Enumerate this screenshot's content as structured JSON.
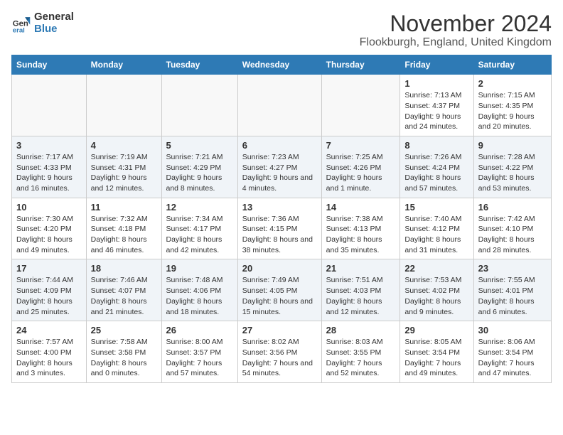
{
  "logo": {
    "line1": "General",
    "line2": "Blue"
  },
  "title": "November 2024",
  "subtitle": "Flookburgh, England, United Kingdom",
  "days_of_week": [
    "Sunday",
    "Monday",
    "Tuesday",
    "Wednesday",
    "Thursday",
    "Friday",
    "Saturday"
  ],
  "weeks": [
    [
      {
        "day": "",
        "info": ""
      },
      {
        "day": "",
        "info": ""
      },
      {
        "day": "",
        "info": ""
      },
      {
        "day": "",
        "info": ""
      },
      {
        "day": "",
        "info": ""
      },
      {
        "day": "1",
        "info": "Sunrise: 7:13 AM\nSunset: 4:37 PM\nDaylight: 9 hours and 24 minutes."
      },
      {
        "day": "2",
        "info": "Sunrise: 7:15 AM\nSunset: 4:35 PM\nDaylight: 9 hours and 20 minutes."
      }
    ],
    [
      {
        "day": "3",
        "info": "Sunrise: 7:17 AM\nSunset: 4:33 PM\nDaylight: 9 hours and 16 minutes."
      },
      {
        "day": "4",
        "info": "Sunrise: 7:19 AM\nSunset: 4:31 PM\nDaylight: 9 hours and 12 minutes."
      },
      {
        "day": "5",
        "info": "Sunrise: 7:21 AM\nSunset: 4:29 PM\nDaylight: 9 hours and 8 minutes."
      },
      {
        "day": "6",
        "info": "Sunrise: 7:23 AM\nSunset: 4:27 PM\nDaylight: 9 hours and 4 minutes."
      },
      {
        "day": "7",
        "info": "Sunrise: 7:25 AM\nSunset: 4:26 PM\nDaylight: 9 hours and 1 minute."
      },
      {
        "day": "8",
        "info": "Sunrise: 7:26 AM\nSunset: 4:24 PM\nDaylight: 8 hours and 57 minutes."
      },
      {
        "day": "9",
        "info": "Sunrise: 7:28 AM\nSunset: 4:22 PM\nDaylight: 8 hours and 53 minutes."
      }
    ],
    [
      {
        "day": "10",
        "info": "Sunrise: 7:30 AM\nSunset: 4:20 PM\nDaylight: 8 hours and 49 minutes."
      },
      {
        "day": "11",
        "info": "Sunrise: 7:32 AM\nSunset: 4:18 PM\nDaylight: 8 hours and 46 minutes."
      },
      {
        "day": "12",
        "info": "Sunrise: 7:34 AM\nSunset: 4:17 PM\nDaylight: 8 hours and 42 minutes."
      },
      {
        "day": "13",
        "info": "Sunrise: 7:36 AM\nSunset: 4:15 PM\nDaylight: 8 hours and 38 minutes."
      },
      {
        "day": "14",
        "info": "Sunrise: 7:38 AM\nSunset: 4:13 PM\nDaylight: 8 hours and 35 minutes."
      },
      {
        "day": "15",
        "info": "Sunrise: 7:40 AM\nSunset: 4:12 PM\nDaylight: 8 hours and 31 minutes."
      },
      {
        "day": "16",
        "info": "Sunrise: 7:42 AM\nSunset: 4:10 PM\nDaylight: 8 hours and 28 minutes."
      }
    ],
    [
      {
        "day": "17",
        "info": "Sunrise: 7:44 AM\nSunset: 4:09 PM\nDaylight: 8 hours and 25 minutes."
      },
      {
        "day": "18",
        "info": "Sunrise: 7:46 AM\nSunset: 4:07 PM\nDaylight: 8 hours and 21 minutes."
      },
      {
        "day": "19",
        "info": "Sunrise: 7:48 AM\nSunset: 4:06 PM\nDaylight: 8 hours and 18 minutes."
      },
      {
        "day": "20",
        "info": "Sunrise: 7:49 AM\nSunset: 4:05 PM\nDaylight: 8 hours and 15 minutes."
      },
      {
        "day": "21",
        "info": "Sunrise: 7:51 AM\nSunset: 4:03 PM\nDaylight: 8 hours and 12 minutes."
      },
      {
        "day": "22",
        "info": "Sunrise: 7:53 AM\nSunset: 4:02 PM\nDaylight: 8 hours and 9 minutes."
      },
      {
        "day": "23",
        "info": "Sunrise: 7:55 AM\nSunset: 4:01 PM\nDaylight: 8 hours and 6 minutes."
      }
    ],
    [
      {
        "day": "24",
        "info": "Sunrise: 7:57 AM\nSunset: 4:00 PM\nDaylight: 8 hours and 3 minutes."
      },
      {
        "day": "25",
        "info": "Sunrise: 7:58 AM\nSunset: 3:58 PM\nDaylight: 8 hours and 0 minutes."
      },
      {
        "day": "26",
        "info": "Sunrise: 8:00 AM\nSunset: 3:57 PM\nDaylight: 7 hours and 57 minutes."
      },
      {
        "day": "27",
        "info": "Sunrise: 8:02 AM\nSunset: 3:56 PM\nDaylight: 7 hours and 54 minutes."
      },
      {
        "day": "28",
        "info": "Sunrise: 8:03 AM\nSunset: 3:55 PM\nDaylight: 7 hours and 52 minutes."
      },
      {
        "day": "29",
        "info": "Sunrise: 8:05 AM\nSunset: 3:54 PM\nDaylight: 7 hours and 49 minutes."
      },
      {
        "day": "30",
        "info": "Sunrise: 8:06 AM\nSunset: 3:54 PM\nDaylight: 7 hours and 47 minutes."
      }
    ]
  ]
}
